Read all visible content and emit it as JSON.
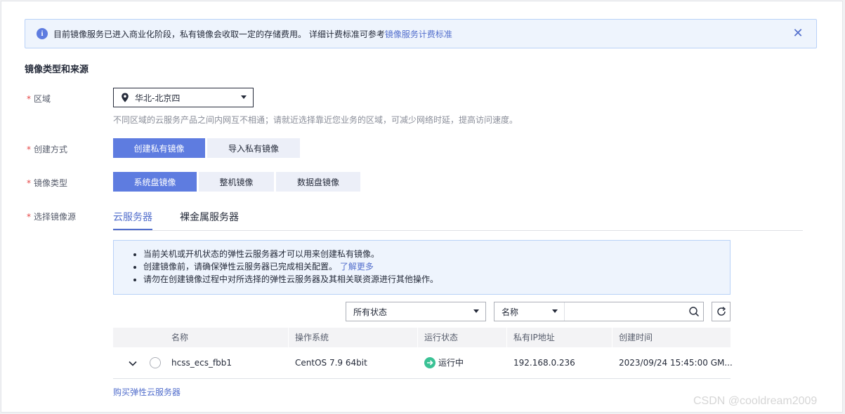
{
  "notice": {
    "text": "目前镜像服务已进入商业化阶段，私有镜像会收取一定的存储费用。 详细计费标准可参考",
    "link": "镜像服务计费标准"
  },
  "section_title": "镜像类型和来源",
  "region": {
    "label": "区域",
    "value": "华北-北京四",
    "help": "不同区域的云服务产品之间内网互不相通；请就近选择靠近您业务的区域，可减少网络时延，提高访问速度。"
  },
  "create_mode": {
    "label": "创建方式",
    "options": [
      "创建私有镜像",
      "导入私有镜像"
    ],
    "selected": "创建私有镜像"
  },
  "image_type": {
    "label": "镜像类型",
    "options": [
      "系统盘镜像",
      "整机镜像",
      "数据盘镜像"
    ],
    "selected": "系统盘镜像"
  },
  "image_source": {
    "label": "选择镜像源",
    "tabs": [
      "云服务器",
      "裸金属服务器"
    ],
    "active_tab": "云服务器"
  },
  "tips": {
    "line1": "当前关机或开机状态的弹性云服务器才可以用来创建私有镜像。",
    "line2": "创建镜像前，请确保弹性云服务器已完成相关配置。",
    "line2_link": "了解更多",
    "line3": "请勿在创建镜像过程中对所选择的弹性云服务器及其相关联资源进行其他操作。"
  },
  "filters": {
    "status": "所有状态",
    "search_field": "名称",
    "search_value": ""
  },
  "table": {
    "columns": [
      "名称",
      "操作系统",
      "运行状态",
      "私有IP地址",
      "创建时间"
    ],
    "rows": [
      {
        "name": "hcss_ecs_fbb1",
        "os": "CentOS 7.9 64bit",
        "status": "运行中",
        "ip": "192.168.0.236",
        "created": "2023/09/24 15:45:00 GM..."
      }
    ]
  },
  "buy_link": "购买弹性云服务器",
  "watermark": "CSDN @cooldream2009",
  "colors": {
    "accent": "#5e7ce0",
    "link": "#526ecc",
    "required": "#e54545",
    "running": "#3ac295"
  }
}
